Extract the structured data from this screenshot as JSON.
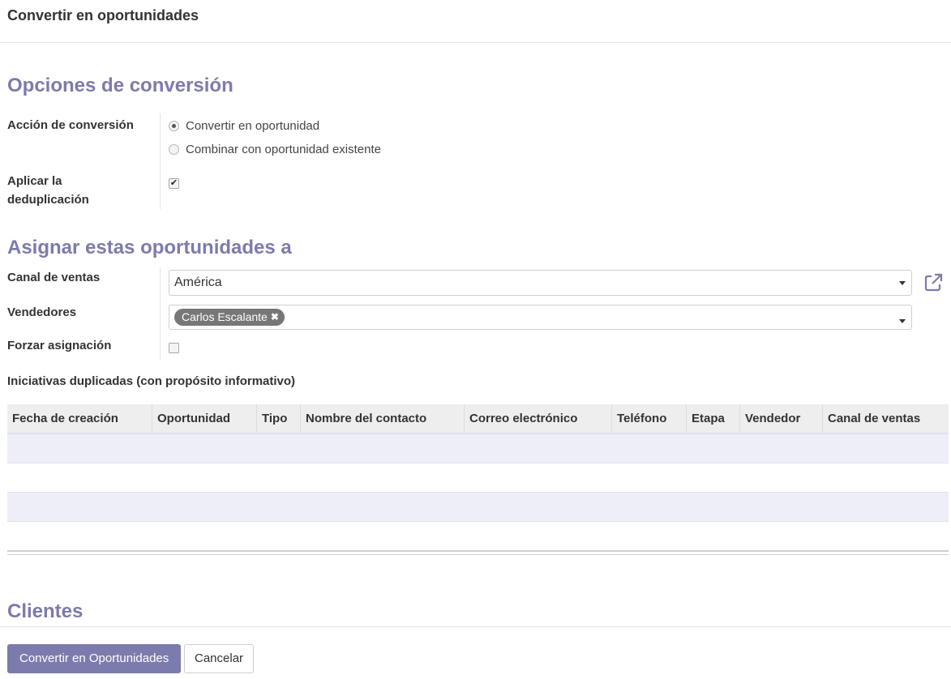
{
  "dialog": {
    "title": "Convertir en oportunidades"
  },
  "conversion": {
    "section_title": "Opciones de conversión",
    "action_label": "Acción de conversión",
    "options": [
      {
        "label": "Convertir en oportunidad",
        "selected": true
      },
      {
        "label": "Combinar con oportunidad existente",
        "selected": false
      }
    ],
    "dedup_label_line1": "Aplicar la",
    "dedup_label_line2": "deduplicación",
    "dedup_checked": true
  },
  "assign": {
    "section_title": "Asignar estas oportunidades a",
    "channel_label": "Canal de ventas",
    "channel_value": "América",
    "sellers_label": "Vendedores",
    "sellers_tags": [
      "Carlos Escalante"
    ],
    "force_label": "Forzar asignación",
    "force_checked": false
  },
  "duplicates": {
    "title": "Iniciativas duplicadas (con propósito informativo)",
    "columns": [
      "Fecha de creación",
      "Oportunidad",
      "Tipo",
      "Nombre del contacto",
      "Correo electrónico",
      "Teléfono",
      "Etapa",
      "Vendedor",
      "Canal de ventas"
    ],
    "rows": []
  },
  "customers": {
    "section_title": "Clientes"
  },
  "footer": {
    "primary_label": "Convertir en Oportunidades",
    "cancel_label": "Cancelar"
  },
  "colors": {
    "accent": "#7c7bad",
    "row_stripe": "#eeeef8",
    "header_bg": "#eeeeee",
    "tag_bg": "#777777"
  },
  "icons": {
    "external_link": "external-link-icon",
    "tag_remove": "close-icon",
    "dropdown": "caret-down-icon"
  }
}
